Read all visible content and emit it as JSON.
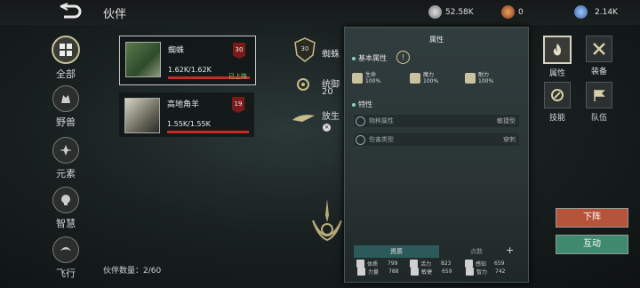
{
  "header": {
    "title": "伙伴"
  },
  "currencies": [
    {
      "icon": "silver-coin-icon",
      "value": "52.58K"
    },
    {
      "icon": "gold-coin-icon",
      "value": "0"
    },
    {
      "icon": "gem-icon",
      "value": "2.14K"
    }
  ],
  "sidebar": {
    "items": [
      {
        "label": "全部",
        "icon": "grid-icon",
        "active": true
      },
      {
        "label": "野兽",
        "icon": "beast-icon"
      },
      {
        "label": "元素",
        "icon": "element-icon"
      },
      {
        "label": "智慧",
        "icon": "wisdom-icon"
      },
      {
        "label": "飞行",
        "icon": "flight-icon"
      }
    ]
  },
  "companions": [
    {
      "name": "蜘蛛",
      "hp": "1.62K/1.62K",
      "hp_fraction": 1.0,
      "level": "30",
      "status": "已上阵",
      "selected": true
    },
    {
      "name": "高地角羊",
      "hp": "1.55K/1.55K",
      "hp_fraction": 1.0,
      "level": "19",
      "status": ""
    }
  ],
  "footer": {
    "count": "伙伴数量：2/60"
  },
  "detail": {
    "level": "30",
    "name": "蜘蛛",
    "stat_label": "统御",
    "stat_value": "20",
    "release": "放生"
  },
  "panel": {
    "title": "属性",
    "basic_title": "基本属性",
    "basic": [
      {
        "name": "生命",
        "value": "100%"
      },
      {
        "name": "魔力",
        "value": "100%"
      },
      {
        "name": "耐力",
        "value": "100%"
      }
    ],
    "trait_title": "特性",
    "traits": [
      {
        "name": "物种属性",
        "value": "敏捷型"
      },
      {
        "name": "伤害类型",
        "value": "穿刺"
      }
    ],
    "tabs": [
      "资质",
      "点数"
    ],
    "stats": [
      {
        "name": "力量",
        "value": "788"
      },
      {
        "name": "敏捷",
        "value": "659"
      },
      {
        "name": "智力",
        "value": "742"
      },
      {
        "name": "体质",
        "value": "799"
      },
      {
        "name": "活力",
        "value": "823"
      },
      {
        "name": "感知",
        "value": "659"
      }
    ]
  },
  "right_menu": [
    {
      "label": "属性",
      "icon": "flame-icon",
      "active": true
    },
    {
      "label": "装备",
      "icon": "crossed-swords-icon"
    },
    {
      "label": "技能",
      "icon": "skill-icon"
    },
    {
      "label": "队伍",
      "icon": "flag-icon"
    }
  ],
  "buttons": {
    "dismiss": "下阵",
    "interact": "互动"
  },
  "colors": {
    "dismiss": "#b5543a",
    "interact": "#3f8a6e",
    "hp_bar": "#c82a2a",
    "level_badge": "#7a1a1a"
  }
}
